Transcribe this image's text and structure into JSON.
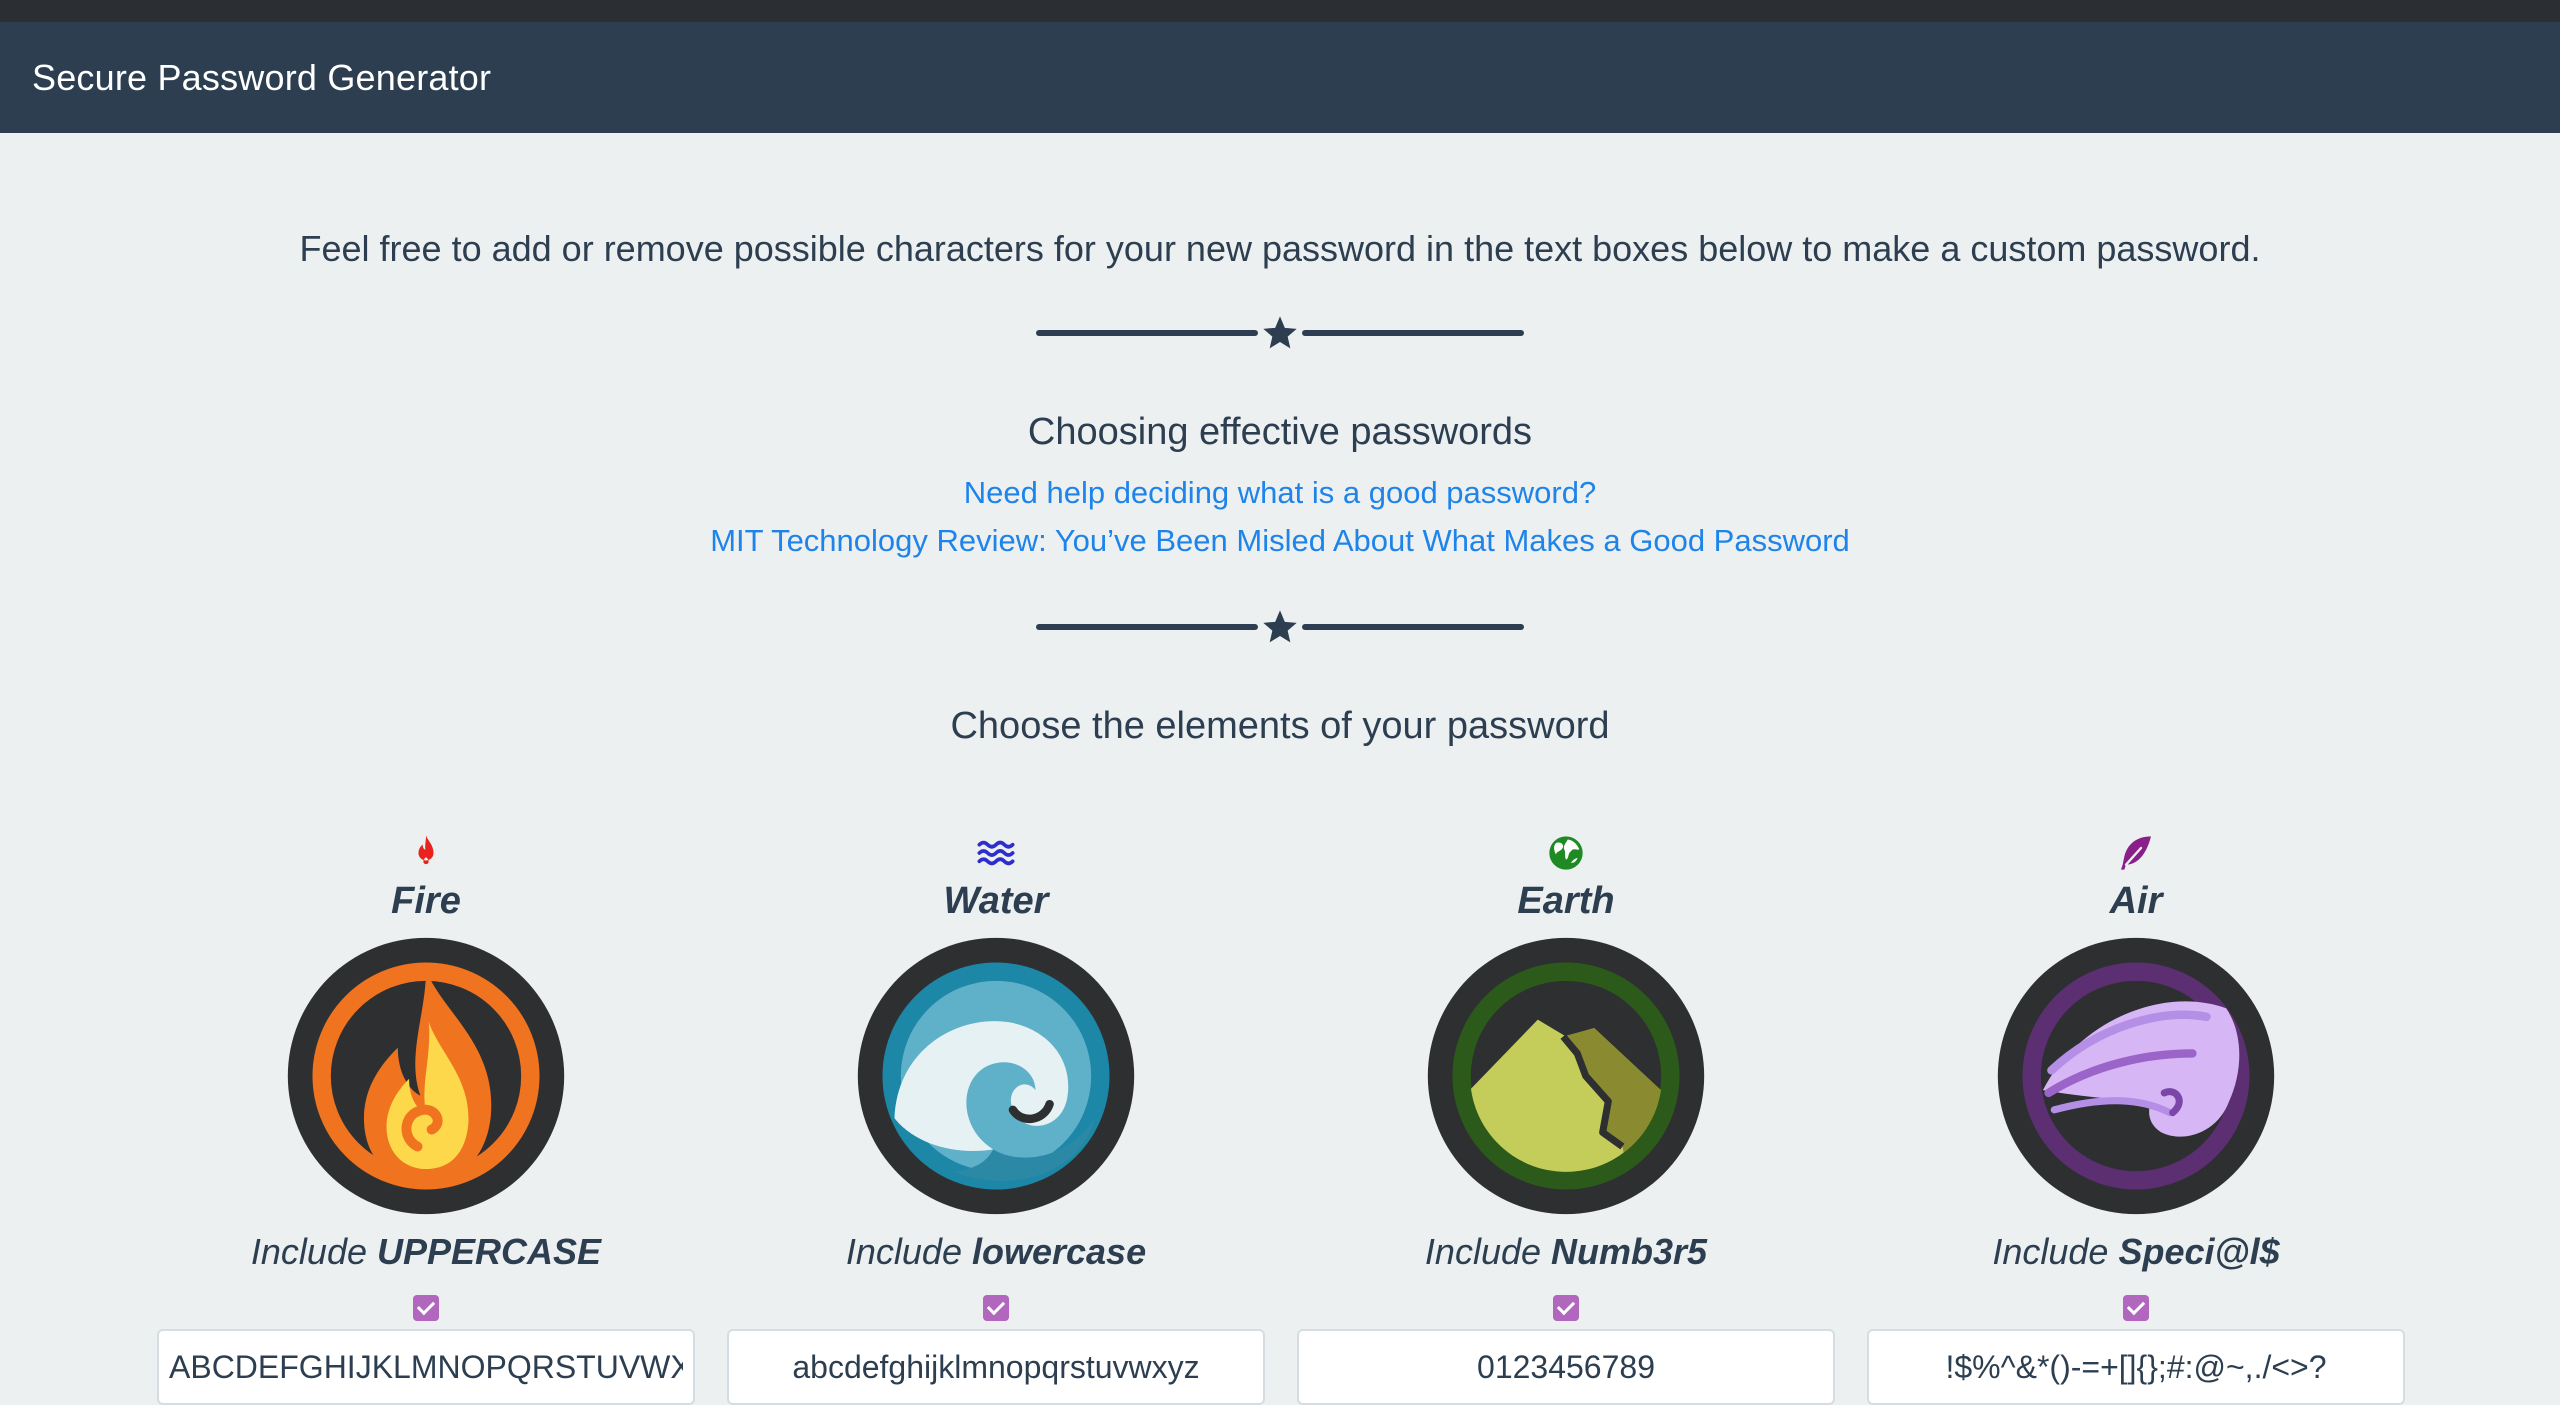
{
  "navbar": {
    "brand": "Secure Password Generator"
  },
  "intro": "Feel free to add or remove possible characters for your new password in the text boxes below to make a custom password.",
  "section1": {
    "heading": "Choosing effective passwords",
    "links": [
      "Need help deciding what is a good password?",
      "MIT Technology Review: You’ve Been Misled About What Makes a Good Password"
    ]
  },
  "section2": {
    "heading": "Choose the elements of your password"
  },
  "elements": [
    {
      "name": "Fire",
      "include_prefix": "Include",
      "include_strong": "UPPERCASE",
      "checked": true,
      "chars": "ABCDEFGHIJKLMNOPQRSTUVWXYZ",
      "icon": "flame-icon",
      "color": "#e8231e"
    },
    {
      "name": "Water",
      "include_prefix": "Include",
      "include_strong": "lowercase",
      "checked": true,
      "chars": "abcdefghijklmnopqrstuvwxyz",
      "icon": "water-waves-icon",
      "color": "#2e2ecc"
    },
    {
      "name": "Earth",
      "include_prefix": "Include",
      "include_strong": "Numb3r5",
      "checked": true,
      "chars": "0123456789",
      "icon": "globe-icon",
      "color": "#1f8a24"
    },
    {
      "name": "Air",
      "include_prefix": "Include",
      "include_strong": "Speci@l$",
      "checked": true,
      "chars": "!$%^&*()-=+[]{};#:@~,./<>?",
      "icon": "feather-icon",
      "color": "#8a1f8a"
    }
  ]
}
